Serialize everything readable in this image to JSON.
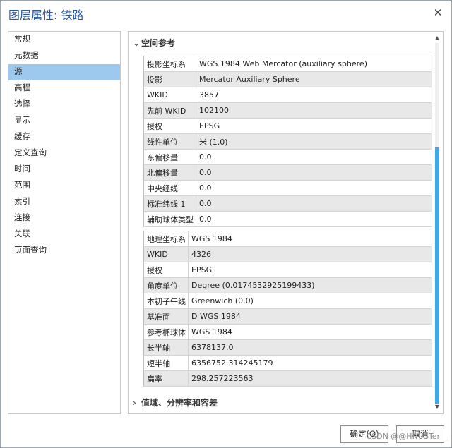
{
  "window": {
    "title": "图层属性: 铁路",
    "close_glyph": "✕"
  },
  "nav": {
    "items": [
      {
        "label": "常规",
        "selected": false
      },
      {
        "label": "元数据",
        "selected": false
      },
      {
        "label": "源",
        "selected": true
      },
      {
        "label": "高程",
        "selected": false
      },
      {
        "label": "选择",
        "selected": false
      },
      {
        "label": "显示",
        "selected": false
      },
      {
        "label": "缓存",
        "selected": false
      },
      {
        "label": "定义查询",
        "selected": false
      },
      {
        "label": "时间",
        "selected": false
      },
      {
        "label": "范围",
        "selected": false
      },
      {
        "label": "索引",
        "selected": false
      },
      {
        "label": "连接",
        "selected": false
      },
      {
        "label": "关联",
        "selected": false
      },
      {
        "label": "页面查询",
        "selected": false
      }
    ]
  },
  "spatial_reference": {
    "header": "空间参考",
    "chevron": "⌄",
    "projected": [
      {
        "key": "投影坐标系",
        "value": "WGS 1984 Web Mercator (auxiliary sphere)"
      },
      {
        "key": "投影",
        "value": "Mercator Auxiliary Sphere"
      },
      {
        "key": "WKID",
        "value": "3857"
      },
      {
        "key": "先前 WKID",
        "value": "102100"
      },
      {
        "key": "授权",
        "value": "EPSG"
      },
      {
        "key": "线性单位",
        "value": "米 (1.0)"
      },
      {
        "key": "东偏移量",
        "value": "0.0"
      },
      {
        "key": "北偏移量",
        "value": "0.0"
      },
      {
        "key": "中央经线",
        "value": "0.0"
      },
      {
        "key": "标准纬线 1",
        "value": "0.0"
      },
      {
        "key": "辅助球体类型",
        "value": "0.0"
      }
    ],
    "geographic": [
      {
        "key": "地理坐标系",
        "value": "WGS 1984"
      },
      {
        "key": "WKID",
        "value": "4326"
      },
      {
        "key": "授权",
        "value": "EPSG"
      },
      {
        "key": "角度单位",
        "value": "Degree (0.0174532925199433)"
      },
      {
        "key": "本初子午线",
        "value": "Greenwich (0.0)"
      },
      {
        "key": "基准面",
        "value": "D WGS 1984"
      },
      {
        "key": "参考椭球体",
        "value": "WGS 1984"
      },
      {
        "key": "长半轴",
        "value": "6378137.0"
      },
      {
        "key": "短半轴",
        "value": "6356752.314245179"
      },
      {
        "key": "扁率",
        "value": "298.257223563"
      }
    ]
  },
  "domain_section": {
    "header": "值域、分辨率和容差",
    "chevron": "›"
  },
  "scrollbar": {
    "up_glyph": "▲",
    "down_glyph": "▼",
    "position_fraction": 0.3
  },
  "buttons": {
    "ok": "确定(O)",
    "cancel": "取消"
  },
  "watermark": "CSDN @@HNUSTer",
  "colors": {
    "title": "#2b579a",
    "selection": "#9ec9ee",
    "scroll_thumb": "#3ea8e8"
  }
}
